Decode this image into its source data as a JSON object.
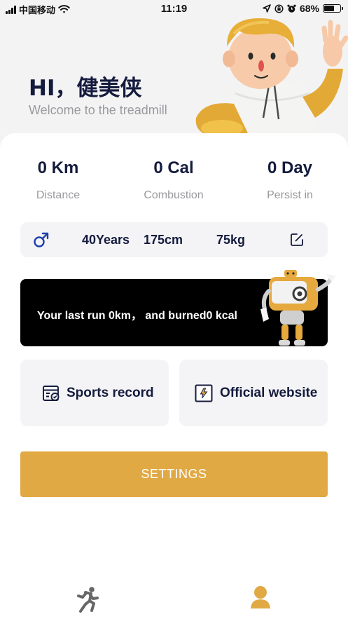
{
  "status_bar": {
    "carrier": "中国移动",
    "time": "11:19",
    "battery": "68%",
    "battery_level": 0.68
  },
  "header": {
    "greeting": "HI，健美侠",
    "welcome": "Welcome to the treadmill"
  },
  "stats": [
    {
      "value": "0 Km",
      "label": "Distance"
    },
    {
      "value": "0 Cal",
      "label": "Combustion"
    },
    {
      "value": "0 Day",
      "label": "Persist in"
    }
  ],
  "profile": {
    "gender_icon": "male-icon",
    "age": "40Years",
    "height": "175cm",
    "weight": "75kg",
    "edit_icon": "edit-icon"
  },
  "banner": {
    "text": "Your last run 0km， and burned0 kcal"
  },
  "tiles": {
    "records_label": "Sports record",
    "website_label": "Official website"
  },
  "settings_label": "SETTINGS",
  "tabbar": {
    "run_icon": "running-icon",
    "me_icon": "user-icon"
  },
  "colors": {
    "accent": "#e1a944",
    "text_dark": "#141b3d",
    "text_muted": "#9a9a9e",
    "male_icon": "#1e3fae"
  }
}
